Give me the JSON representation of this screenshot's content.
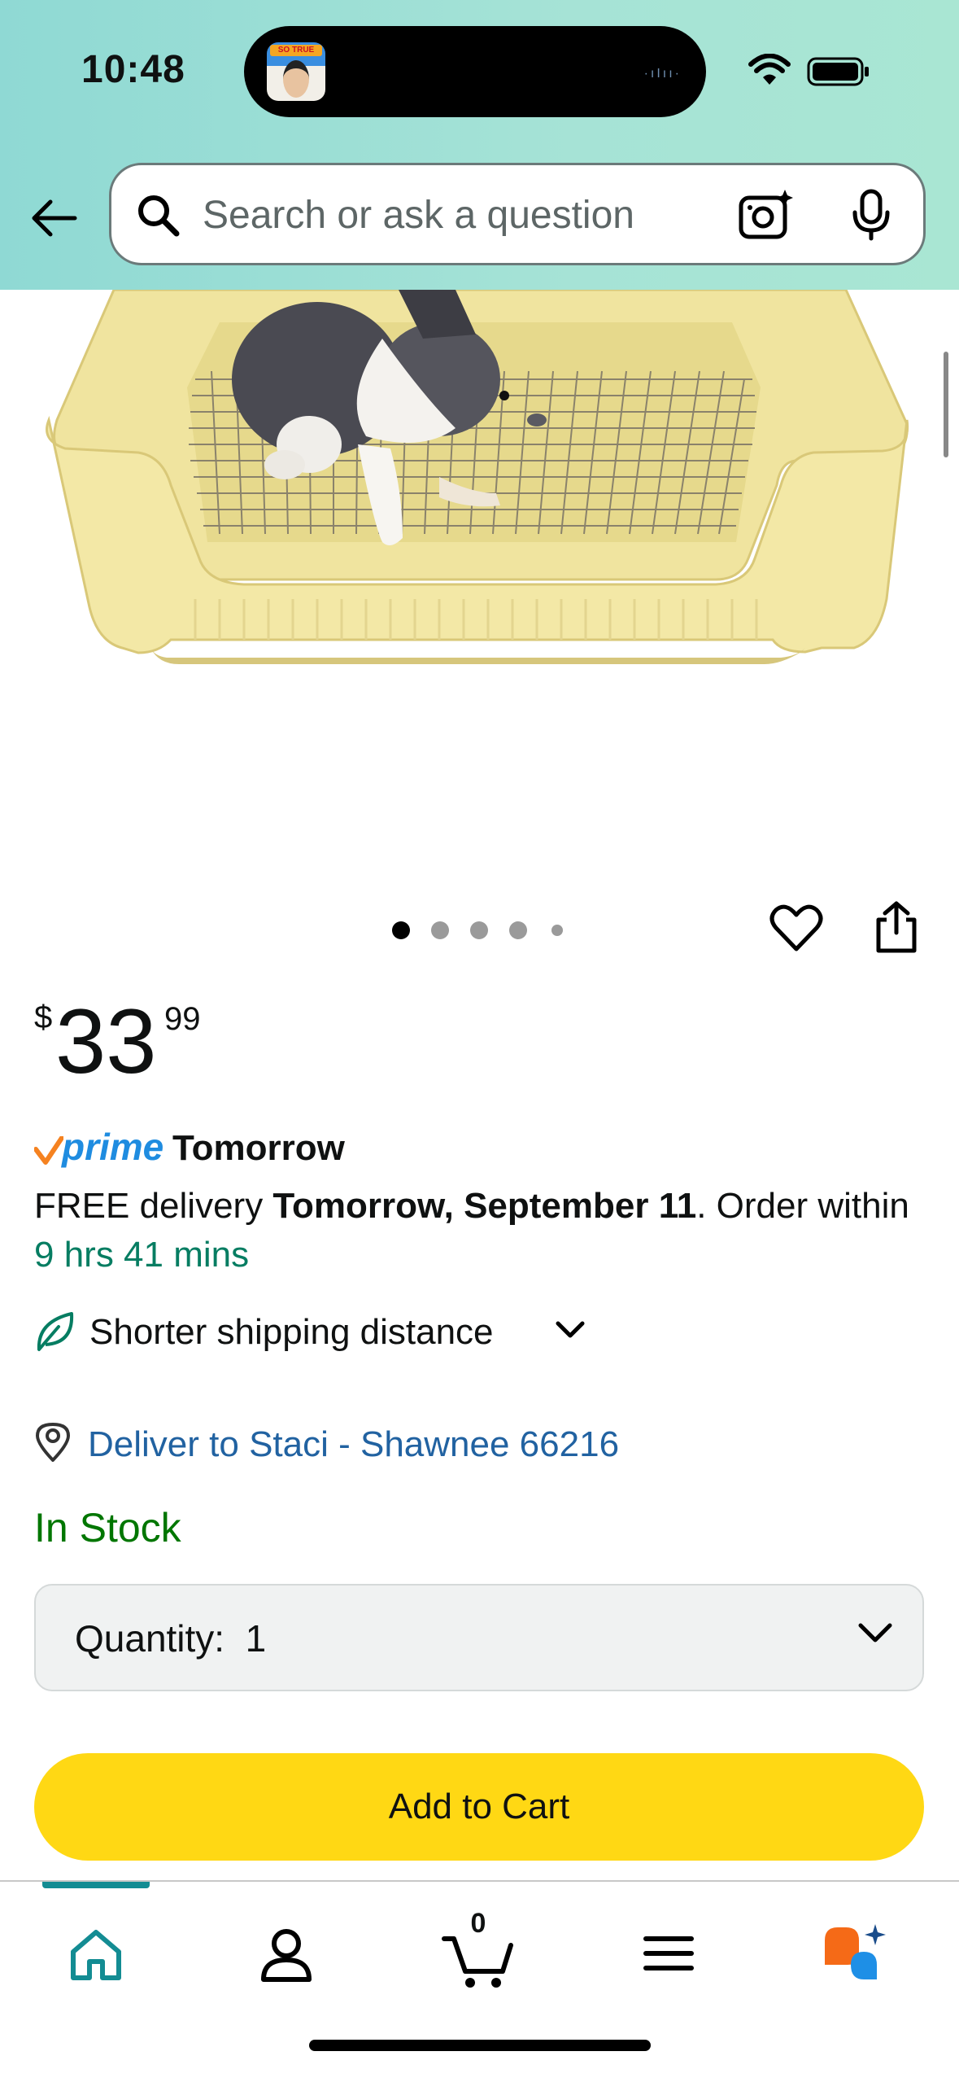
{
  "status_bar": {
    "time": "10:48",
    "island_badge": "SO TRUE"
  },
  "header": {
    "search": {
      "placeholder": "Search or ask a question"
    }
  },
  "carousel": {
    "dot_count": 5,
    "active_index": 0
  },
  "price": {
    "currency": "$",
    "whole": "33",
    "fraction": "99"
  },
  "prime": {
    "badge": "prime",
    "label": "Tomorrow"
  },
  "delivery": {
    "prefix": "FREE delivery ",
    "date": "Tomorrow, September 11",
    "order_within_prefix": ". Order within ",
    "countdown": "9 hrs 41 mins"
  },
  "shipping": {
    "label": "Shorter shipping distance"
  },
  "deliver_to": {
    "label": "Deliver to Staci - Shawnee 66216"
  },
  "stock": {
    "label": "In Stock"
  },
  "quantity": {
    "label": "Quantity:",
    "value": "1"
  },
  "add_to_cart": {
    "label": "Add to Cart"
  },
  "tabbar": {
    "items": [
      "home",
      "account",
      "cart",
      "menu",
      "rufus"
    ],
    "cart_count": "0",
    "active": "home"
  },
  "colors": {
    "header_gradient": "#a6e3d6",
    "add_to_cart": "#ffd814",
    "link_blue": "#2162a1",
    "stock_green": "#007600",
    "countdown_green": "#067d62",
    "prime_blue": "#1f8ce0",
    "active_tab": "#138c93"
  }
}
